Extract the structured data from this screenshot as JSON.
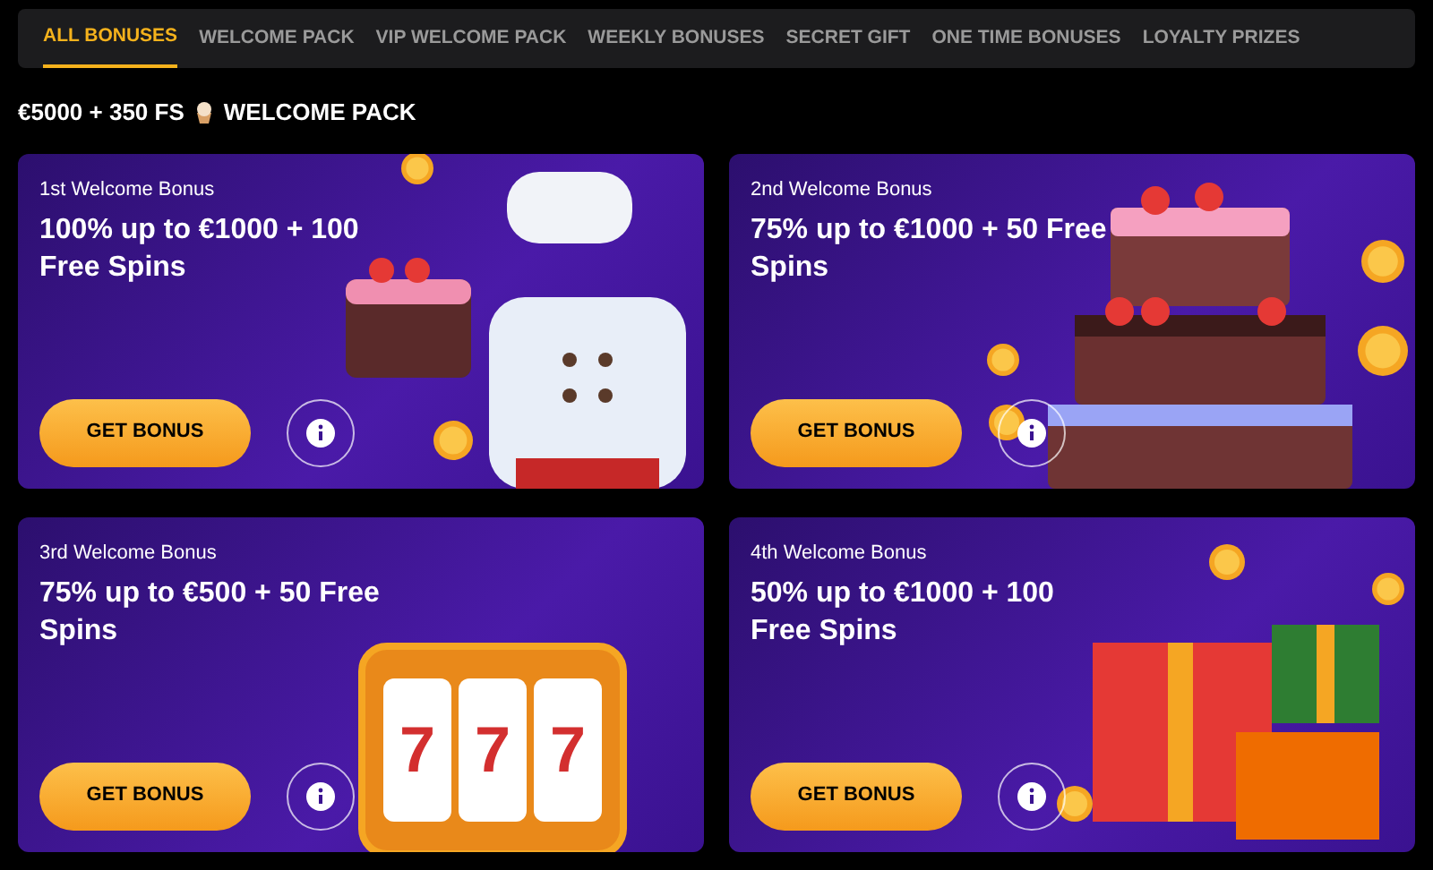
{
  "tabs": [
    {
      "label": "ALL BONUSES",
      "selected": true
    },
    {
      "label": "WELCOME PACK",
      "selected": false
    },
    {
      "label": "VIP WELCOME PACK",
      "selected": false
    },
    {
      "label": "WEEKLY BONUSES",
      "selected": false
    },
    {
      "label": "SECRET GIFT",
      "selected": false
    },
    {
      "label": "ONE TIME BONUSES",
      "selected": false
    },
    {
      "label": "LOYALTY PRIZES",
      "selected": false
    }
  ],
  "section": {
    "title_before_icon": "€5000 + 350 FS",
    "title_after_icon": "WELCOME PACK"
  },
  "cards": [
    {
      "label": "1st Welcome Bonus",
      "headline": "100% up to €1000 + 100 Free Spins",
      "button": "GET BONUS",
      "kind": "cake"
    },
    {
      "label": "2nd Welcome Bonus",
      "headline": "75% up to €1000 + 50 Free Spins",
      "button": "GET BONUS",
      "kind": "tiered-cake"
    },
    {
      "label": "3rd Welcome Bonus",
      "headline": "75% up to €500 + 50 Free Spins",
      "button": "GET BONUS",
      "kind": "slot-machine",
      "reels": [
        "7",
        "7",
        "7"
      ]
    },
    {
      "label": "4th Welcome Bonus",
      "headline": "50% up to €1000 + 100 Free Spins",
      "button": "GET BONUS",
      "kind": "gifts"
    }
  ]
}
